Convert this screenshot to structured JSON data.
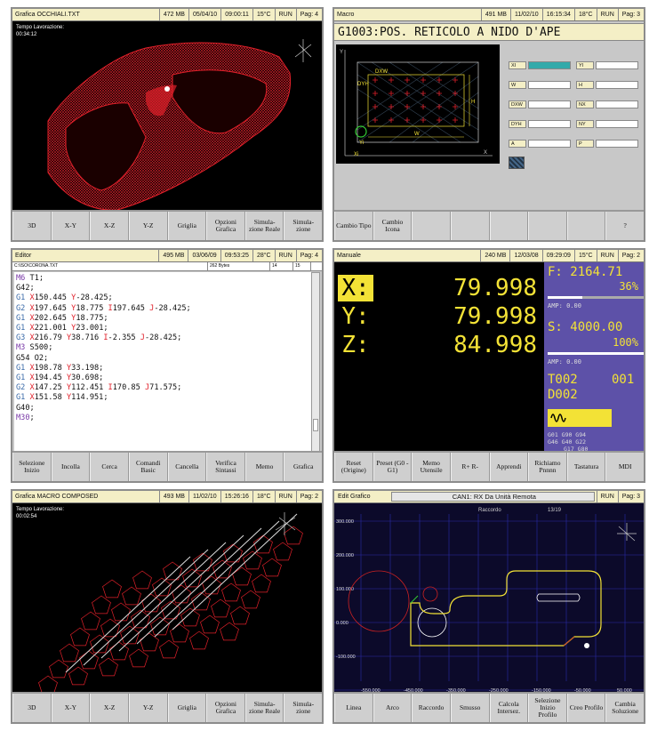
{
  "p1": {
    "title": "Grafica OCCHIALI.TXT",
    "mem": "472 MB",
    "date": "05/04/10",
    "time": "09:00:11",
    "temp": "15°C",
    "state": "RUN",
    "page": "Pag: 4",
    "work_label": "Tempo Lavorazione:",
    "work_time": "00:34:12",
    "keys": [
      "3D",
      "X-Y",
      "X-Z",
      "Y-Z",
      "Griglia",
      "Opzioni Grafica",
      "Simula-zione Reale",
      "Simula-zione"
    ]
  },
  "p2": {
    "title": "Macro",
    "mem": "491 MB",
    "date": "11/02/10",
    "time": "16:15:34",
    "temp": "18°C",
    "state": "RUN",
    "page": "Pag: 3",
    "heading": "G1003:POS. RETICOLO A NIDO D'APE",
    "fields": [
      "XI",
      "YI",
      "W",
      "H",
      "DXW",
      "NX",
      "DYH",
      "NY",
      "A",
      "P"
    ],
    "diagram_labels": {
      "y": "Y",
      "x": "X",
      "dxw": "DXW",
      "dyh": "DYH",
      "w": "W",
      "h": "H",
      "xi": "Xi",
      "yi": "Yi"
    },
    "keys": [
      "Cambio Tipo",
      "Cambio Icona",
      "",
      "",
      "",
      "",
      "",
      "?"
    ]
  },
  "p3": {
    "title": "Editor",
    "mem": "495 MB",
    "date": "03/06/09",
    "time": "09:53:25",
    "temp": "28°C",
    "state": "RUN",
    "page": "Pag: 4",
    "file": "C:\\ISO\\CORONA.TXT",
    "bytes": "262 Bytes",
    "col1": "14",
    "col2": "15",
    "keys": [
      "Selezione Inizio",
      "Incolla",
      "Cerca",
      "Comandi Basic",
      "Cancella",
      "Verifica Sintassi",
      "Memo",
      "Grafica"
    ]
  },
  "p4": {
    "title": "Manuale",
    "mem": "240 MB",
    "date": "12/03/08",
    "time": "09:29:09",
    "temp": "15°C",
    "state": "RUN",
    "page": "Pag: 2",
    "axes": [
      {
        "l": "X:",
        "v": "79.998"
      },
      {
        "l": "Y:",
        "v": "79.998"
      },
      {
        "l": "Z:",
        "v": "84.998"
      }
    ],
    "feed": "F:  2164.71",
    "feed_pct": "36%",
    "amp1": "AMP:  0.00",
    "speed": "S:  4000.00",
    "speed_pct": "100%",
    "amp2": "AMP:  0.00",
    "tool": "T002",
    "tool_n": "001",
    "d": "D002",
    "gcodes1": "G01  G90  G94",
    "gcodes2": "G46  G40  G22",
    "gcodes3": "G17  G80",
    "keys": [
      "Reset (Origine)",
      "Preset (G0 - G1)",
      "Memo Utensile",
      "R+ R-",
      "Apprendi",
      "Richiamo Pnnnn",
      "Tastatura",
      "MDI"
    ]
  },
  "p5": {
    "title": "Grafica MACRO COMPOSED",
    "mem": "493 MB",
    "date": "11/02/10",
    "time": "15:26:16",
    "temp": "18°C",
    "state": "RUN",
    "page": "Pag: 2",
    "work_label": "Tempo Lavorazione:",
    "work_time": "00:02:54",
    "keys": [
      "3D",
      "X-Y",
      "X-Z",
      "Y-Z",
      "Griglia",
      "Opzioni Grafica",
      "Simula-zione Reale",
      "Simula-zione"
    ]
  },
  "p6": {
    "title": "Edit Grafico",
    "msg": "CAN1: RX Da Unità Remota",
    "state": "RUN",
    "page": "Pag: 3",
    "sub": "Raccordo",
    "count": "13/19",
    "yticks": [
      "300.000",
      "200.000",
      "100.000",
      "0.000",
      "-100.000"
    ],
    "xticks": [
      "-550.000",
      "-450.000",
      "-350.000",
      "-250.000",
      "-150.000",
      "-50.000",
      "50.000"
    ],
    "keys": [
      "Linea",
      "Arco",
      "Raccordo",
      "Smusso",
      "Calcola Intersez.",
      "Selezione Inizio Profilo",
      "Creo Profilo",
      "Cambia Soluzione"
    ]
  },
  "colors": {
    "red": "#e0202a",
    "yellow": "#f3e236",
    "purple": "#5d51a8",
    "titlebar": "#f4efc6"
  }
}
